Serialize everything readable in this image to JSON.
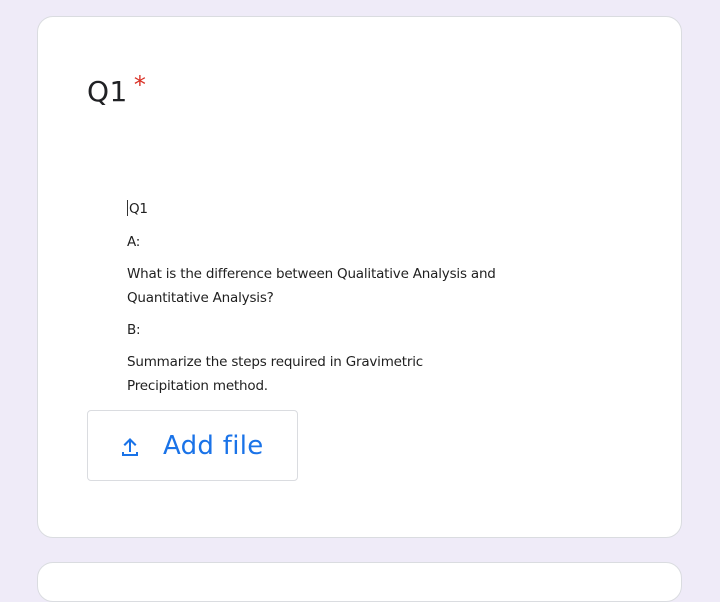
{
  "question": {
    "title": "Q1",
    "required_marker": "*",
    "image_lines": {
      "header": "Q1",
      "label_a": "A:",
      "question_a_line1": "What is the difference between Qualitative Analysis and",
      "question_a_line2": "Quantitative Analysis?",
      "label_b": "B:",
      "question_b_line1": "Summarize the steps required in Gravimetric",
      "question_b_line2": "Precipitation method."
    }
  },
  "upload": {
    "button_label": "Add file",
    "icon": "upload-icon"
  },
  "colors": {
    "page_background": "#efebf8",
    "card_background": "#ffffff",
    "accent": "#1a73e8",
    "required": "#d93025"
  }
}
